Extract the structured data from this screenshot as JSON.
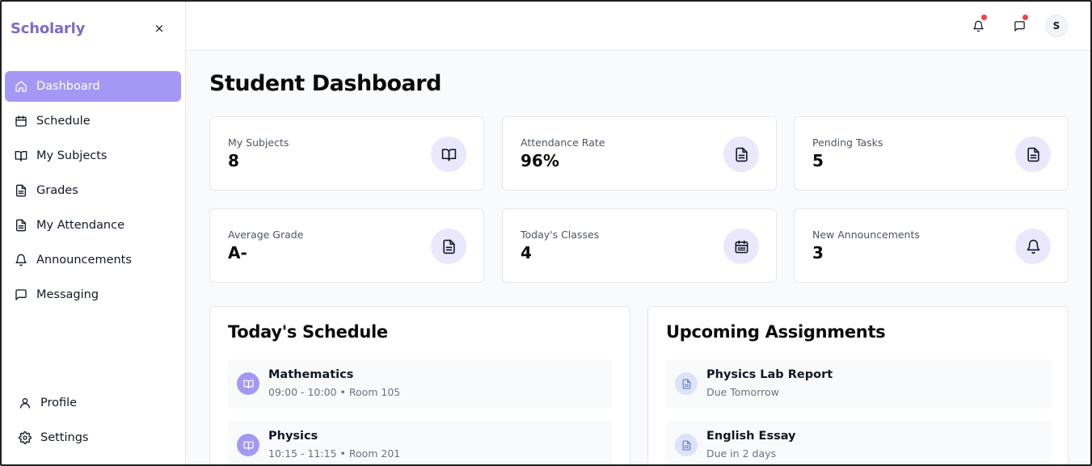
{
  "brand": "Scholarly",
  "sidebar": {
    "close_label": "×",
    "items": [
      {
        "label": "Dashboard",
        "icon": "home-icon",
        "active": true
      },
      {
        "label": "Schedule",
        "icon": "calendar-icon"
      },
      {
        "label": "My Subjects",
        "icon": "book-icon"
      },
      {
        "label": "Grades",
        "icon": "file-icon"
      },
      {
        "label": "My Attendance",
        "icon": "file-icon"
      },
      {
        "label": "Announcements",
        "icon": "bell-icon"
      },
      {
        "label": "Messaging",
        "icon": "message-icon"
      }
    ],
    "bottom": [
      {
        "label": "Profile",
        "icon": "user-icon"
      },
      {
        "label": "Settings",
        "icon": "gear-icon"
      }
    ]
  },
  "topbar": {
    "avatar_initial": "S",
    "notifications_icon": "bell-icon",
    "messages_icon": "message-icon"
  },
  "page_title": "Student Dashboard",
  "stats": [
    {
      "label": "My Subjects",
      "value": "8",
      "icon": "book-icon"
    },
    {
      "label": "Attendance Rate",
      "value": "96%",
      "icon": "file-icon"
    },
    {
      "label": "Pending Tasks",
      "value": "5",
      "icon": "file-icon"
    },
    {
      "label": "Average Grade",
      "value": "A-",
      "icon": "file-icon"
    },
    {
      "label": "Today's Classes",
      "value": "4",
      "icon": "calendar-icon"
    },
    {
      "label": "New Announcements",
      "value": "3",
      "icon": "bell-icon"
    }
  ],
  "schedule": {
    "title": "Today's Schedule",
    "items": [
      {
        "title": "Mathematics",
        "detail": "09:00 - 10:00 • Room 105"
      },
      {
        "title": "Physics",
        "detail": "10:15 - 11:15 • Room 201"
      }
    ]
  },
  "assignments": {
    "title": "Upcoming Assignments",
    "items": [
      {
        "title": "Physics Lab Report",
        "detail": "Due Tomorrow"
      },
      {
        "title": "English Essay",
        "detail": "Due in 2 days"
      }
    ]
  },
  "colors": {
    "accent": "#a598f4",
    "brand": "#7c6cc4",
    "badge_bg": "#ebe7fd",
    "notification_dot": "#ef4444"
  }
}
